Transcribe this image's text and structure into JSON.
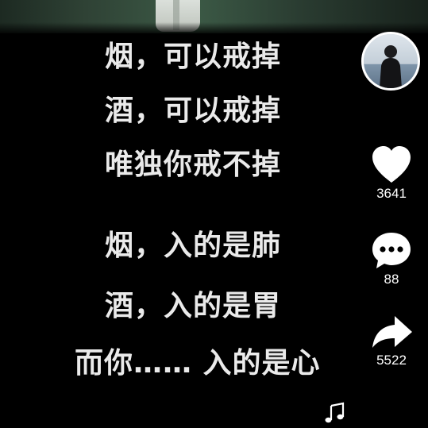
{
  "lyrics": [
    "烟，可以戒掉",
    "酒，可以戒掉",
    "唯独你戒不掉",
    "烟，入的是肺",
    "酒，入的是胃",
    "而你…… 入的是心"
  ],
  "actions": {
    "like": {
      "icon": "heart-icon",
      "count": "3641"
    },
    "comment": {
      "icon": "comment-icon",
      "count": "88"
    },
    "share": {
      "icon": "share-icon",
      "count": "5522"
    }
  },
  "profile": {
    "icon": "avatar"
  },
  "music": {
    "icon": "music-note-icon"
  },
  "colors": {
    "background": "#000000",
    "lyric_text": "#eaeaea",
    "icon": "#ffffff"
  }
}
